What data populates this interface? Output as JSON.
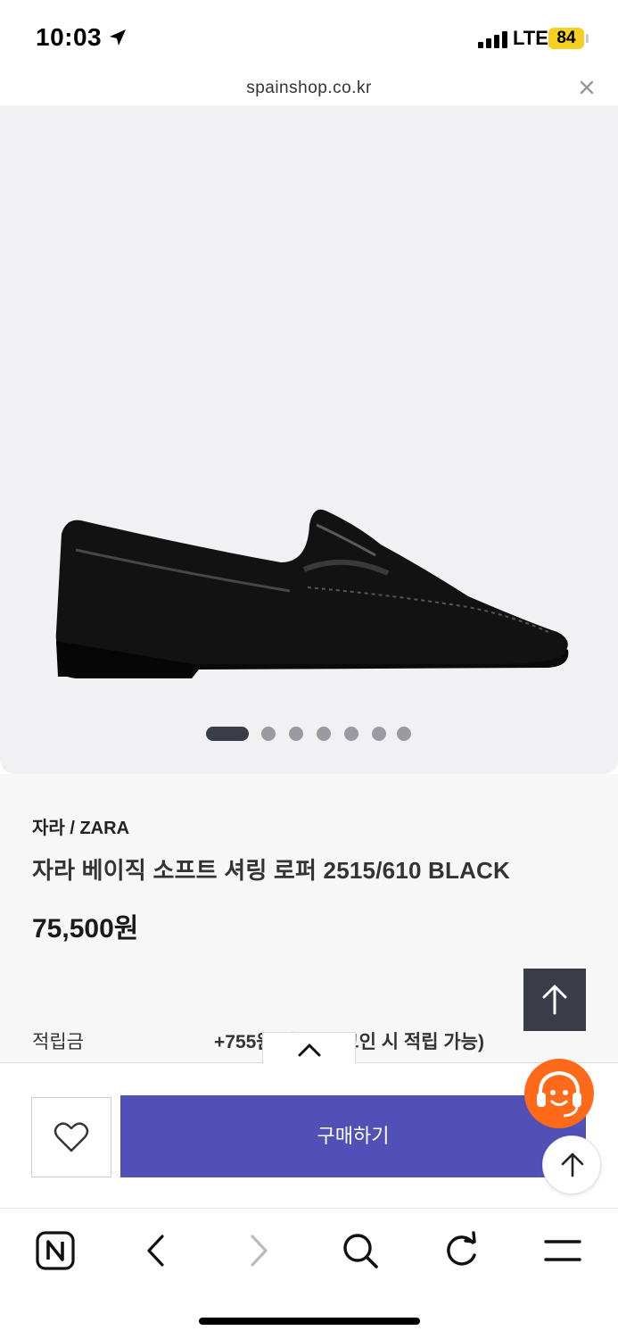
{
  "status_bar": {
    "time": "10:03",
    "network": "LTE",
    "battery": "84",
    "battery_color": "#f5d020"
  },
  "browser": {
    "url": "spainshop.co.kr"
  },
  "gallery": {
    "image_icon": "black-loafer-shoe",
    "slide_count": 7,
    "active_slide": 1
  },
  "product": {
    "brand": "자라 / ZARA",
    "title": "자라 베이직 소프트 셔링 로퍼 2515/610 BLACK",
    "price": "75,500원",
    "points_label": "적립금",
    "points_value": "+755원 적립 (로그인 시 적립 가능)"
  },
  "actions": {
    "buy_label": "구매하기",
    "buy_color": "#5050b7",
    "cs_color": "#ff6a1a"
  },
  "toolbar": {
    "items": [
      "naver-home-icon",
      "back-icon",
      "forward-icon",
      "search-icon",
      "refresh-icon",
      "menu-icon"
    ]
  }
}
